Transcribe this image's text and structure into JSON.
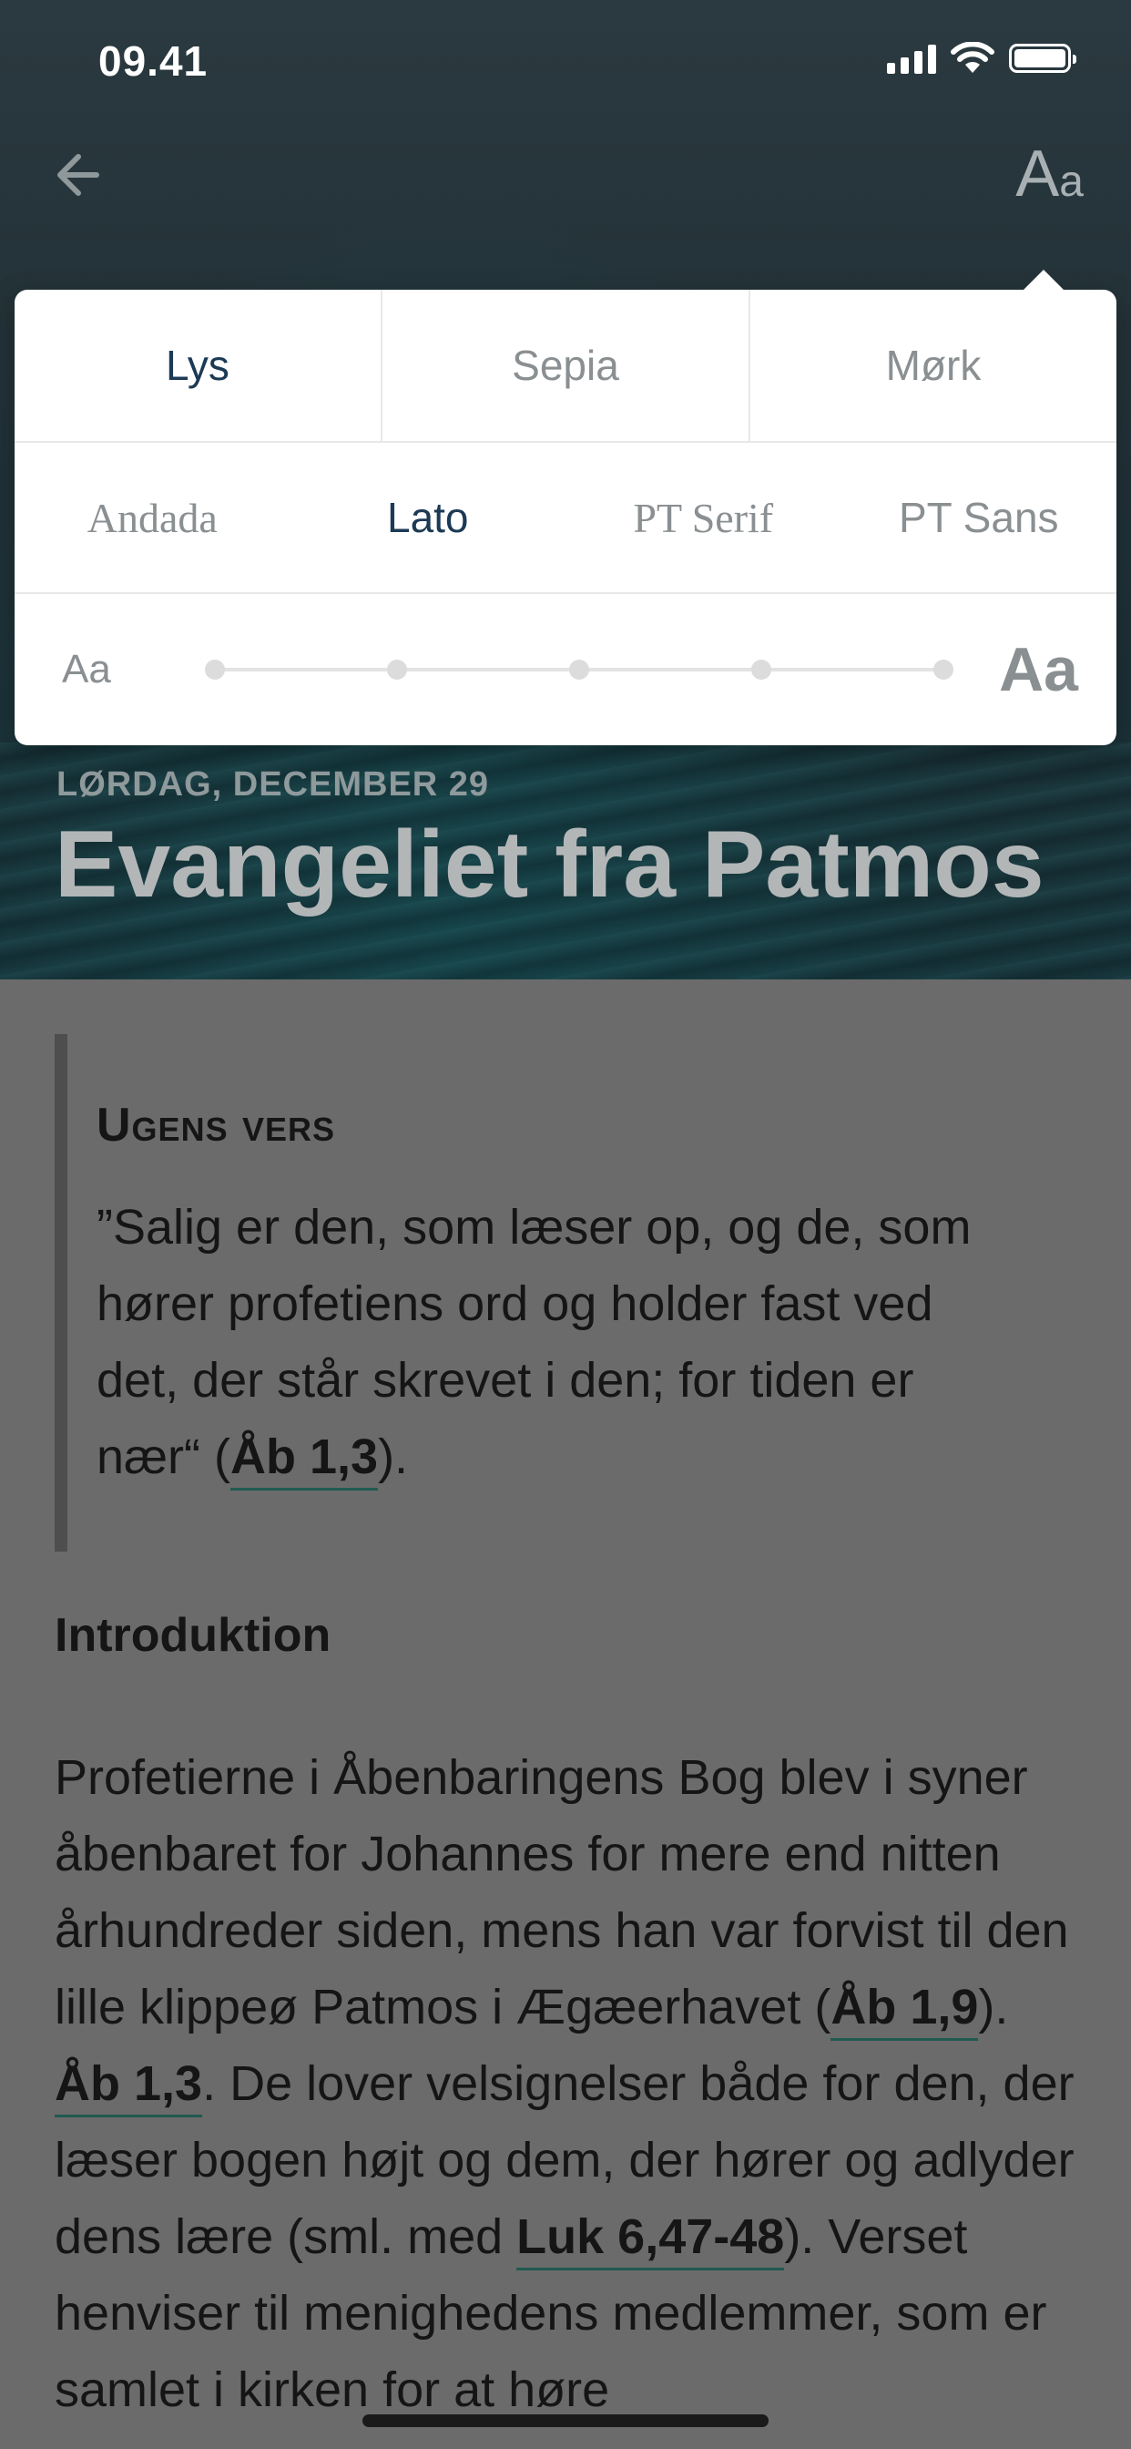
{
  "status_bar": {
    "time": "09.41"
  },
  "nav": {
    "font_big": "A",
    "font_small": "a"
  },
  "hero": {
    "date": "LØRDAG, DECEMBER 29",
    "title": "Evangeliet fra Patmos"
  },
  "popover": {
    "themes": [
      {
        "label": "Lys",
        "active": true
      },
      {
        "label": "Sepia",
        "active": false
      },
      {
        "label": "Mørk",
        "active": false
      }
    ],
    "fonts": [
      {
        "label": "Andada",
        "active": false
      },
      {
        "label": "Lato",
        "active": true
      },
      {
        "label": "PT Serif",
        "active": false
      },
      {
        "label": "PT Sans",
        "active": false
      }
    ],
    "size_small_label": "Aa",
    "size_large_label": "Aa",
    "size_steps": 5
  },
  "content": {
    "quote_heading": "Ugens vers",
    "quote_text": "”Salig er den, som læser op, og de, som hører profetiens ord og holder fast ved det, der står skrevet i den; for tiden er nær“ (",
    "quote_ref": "Åb 1,3",
    "quote_end": ").",
    "intro_heading": "Introduktion",
    "intro_p1": "Profetierne i Åbenbaringens Bog blev i syner åbenbaret for Johannes for mere end nitten århundreder siden, mens han var forvist til den lille klippeø Patmos i Ægæerhavet (",
    "intro_ref1": "Åb 1,9",
    "intro_p2": "). ",
    "intro_ref2": "Åb 1,3",
    "intro_p3": ". De lover velsignelser både for den, der læser bogen højt og dem, der hører og adlyder dens lære (sml. med ",
    "intro_ref3": "Luk 6,47-48",
    "intro_p4": "). Verset henviser til menighedens medlemmer, som er samlet i kirken for at høre"
  }
}
